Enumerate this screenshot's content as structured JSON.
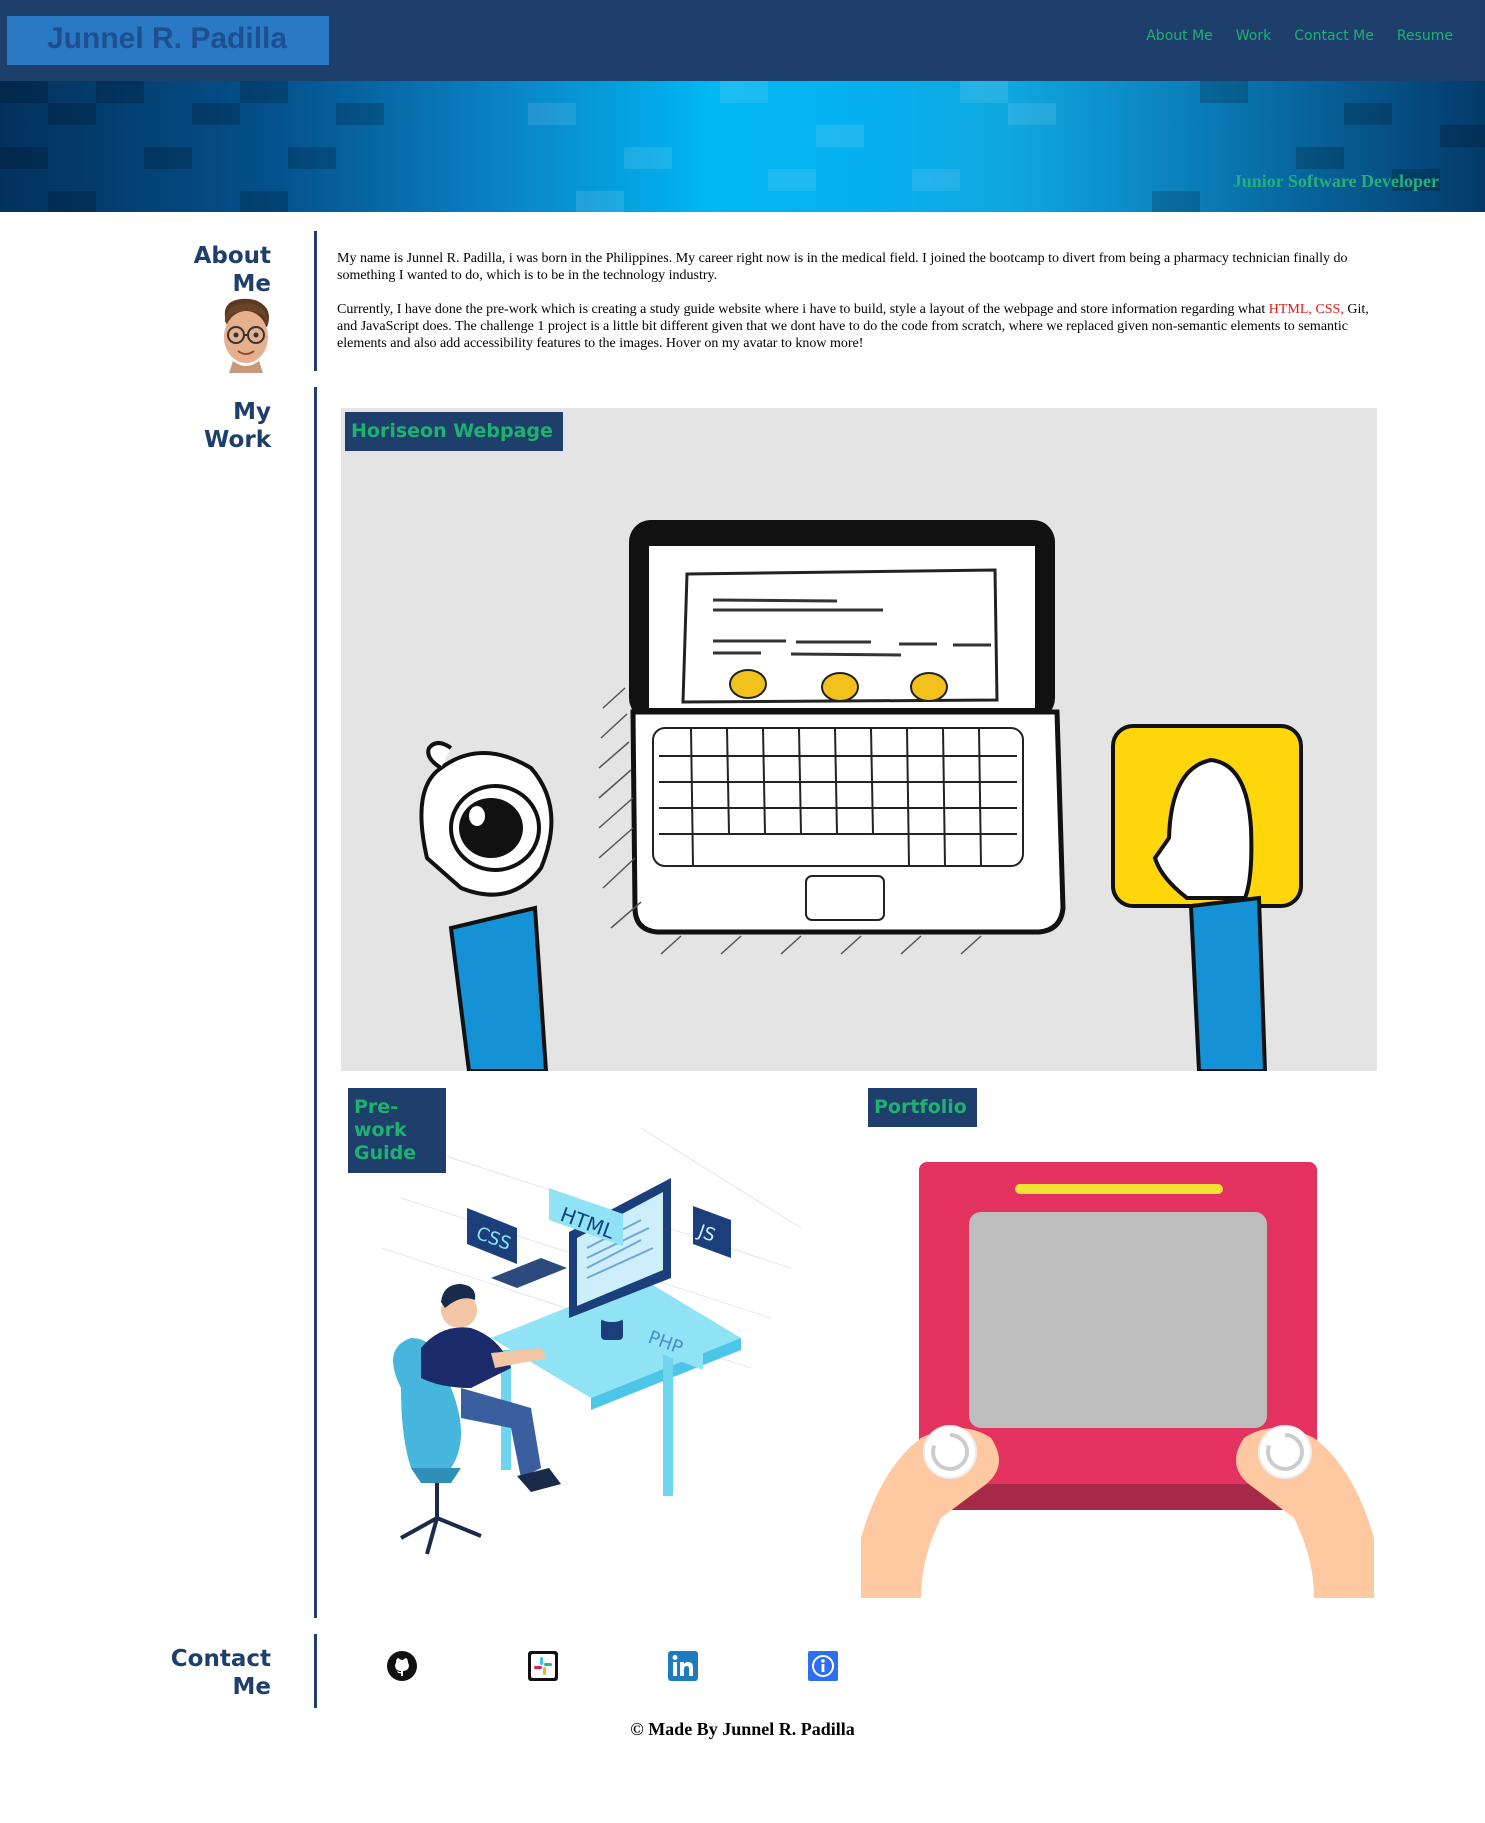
{
  "header": {
    "logo": "Junnel R. Padilla",
    "nav": [
      {
        "label": "About Me"
      },
      {
        "label": "Work"
      },
      {
        "label": "Contact Me"
      },
      {
        "label": "Resume"
      }
    ]
  },
  "banner": {
    "subtitle": "Junior Software Developer"
  },
  "about": {
    "title_line1": "About",
    "title_line2": "Me",
    "para1": "My name is Junnel R. Padilla, i was born in the Philippines. My career right now is in the medical field. I joined the bootcamp to divert from being a pharmacy technician finally do something I wanted to do, which is to be in the technology industry.",
    "para2_a": "Currently, I have done the pre-work which is creating a study guide website where i have to build, style a layout of the webpage and store information regarding what ",
    "para2_html": "HTML,",
    "para2_css": "CSS,",
    "para2_b": " Git, and JavaScript does. The challenge 1 project is a little bit different given that we dont have to do the code from scratch, where we replaced given non-semantic elements to semantic elements and also add accessibility features to the images. Hover on my avatar to know more!"
  },
  "work": {
    "title_line1": "My",
    "title_line2": "Work",
    "projects": [
      {
        "label": "Horiseon Webpage"
      },
      {
        "label": "Pre-work Guide"
      },
      {
        "label": "Portfolio"
      }
    ],
    "prework_tags": [
      "HTML",
      "CSS",
      "JS",
      "PHP"
    ]
  },
  "contact": {
    "title_line1": "Contact",
    "title_line2": "Me",
    "icons": [
      "github-icon",
      "slack-icon",
      "linkedin-icon",
      "info-icon"
    ]
  },
  "footer": {
    "text": "© Made By Junnel R. Padilla"
  },
  "colors": {
    "navy": "#1e3f6b",
    "green": "#1db26f",
    "highlight_red": "#e01818"
  }
}
